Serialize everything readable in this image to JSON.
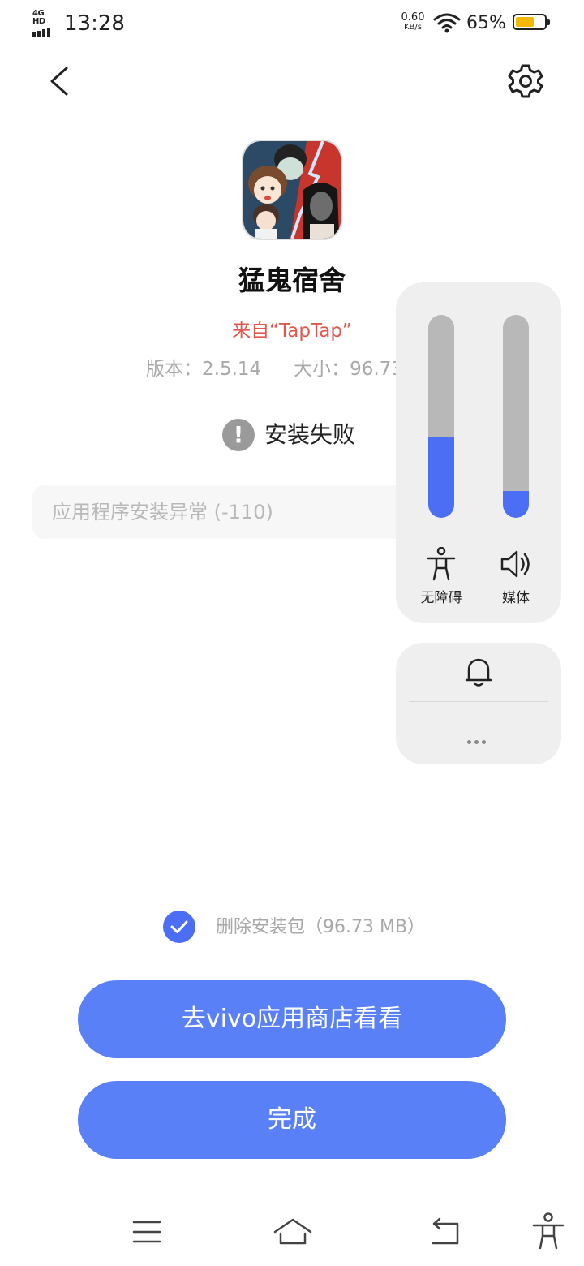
{
  "status_bar": {
    "network": "4G HD",
    "time": "13:28",
    "net_speed_value": "0.60",
    "net_speed_unit": "KB/s",
    "battery_percent": "65%",
    "battery_level": 0.65,
    "battery_color": "#f5b800"
  },
  "header": {
    "back_icon": "chevron-left-icon",
    "settings_icon": "gear-icon"
  },
  "app": {
    "name": "猛鬼宿舍",
    "source": "来自“TapTap”",
    "version": "版本：2.5.14",
    "size": "大小：96.73",
    "status": "安装失败",
    "error": "应用程序安装异常 (-110)"
  },
  "volume_panel": {
    "accessibility_label": "无障碍",
    "media_label": "媒体",
    "accessibility_level": 0.4,
    "media_level": 0.13,
    "accent_color": "#4b6ef5"
  },
  "ringer_panel": {
    "bell_icon": "bell-icon",
    "more_icon": "more-dots-icon"
  },
  "actions": {
    "delete_package_label": "删除安装包（96.73 MB）",
    "delete_package_checked": true,
    "store_button": "去vivo应用商店看看",
    "done_button": "完成",
    "button_color": "#5a80f8"
  },
  "nav_bar": {
    "menu_icon": "menu-icon",
    "home_icon": "home-icon",
    "back_icon": "back-icon",
    "accessibility_icon": "accessibility-icon"
  }
}
